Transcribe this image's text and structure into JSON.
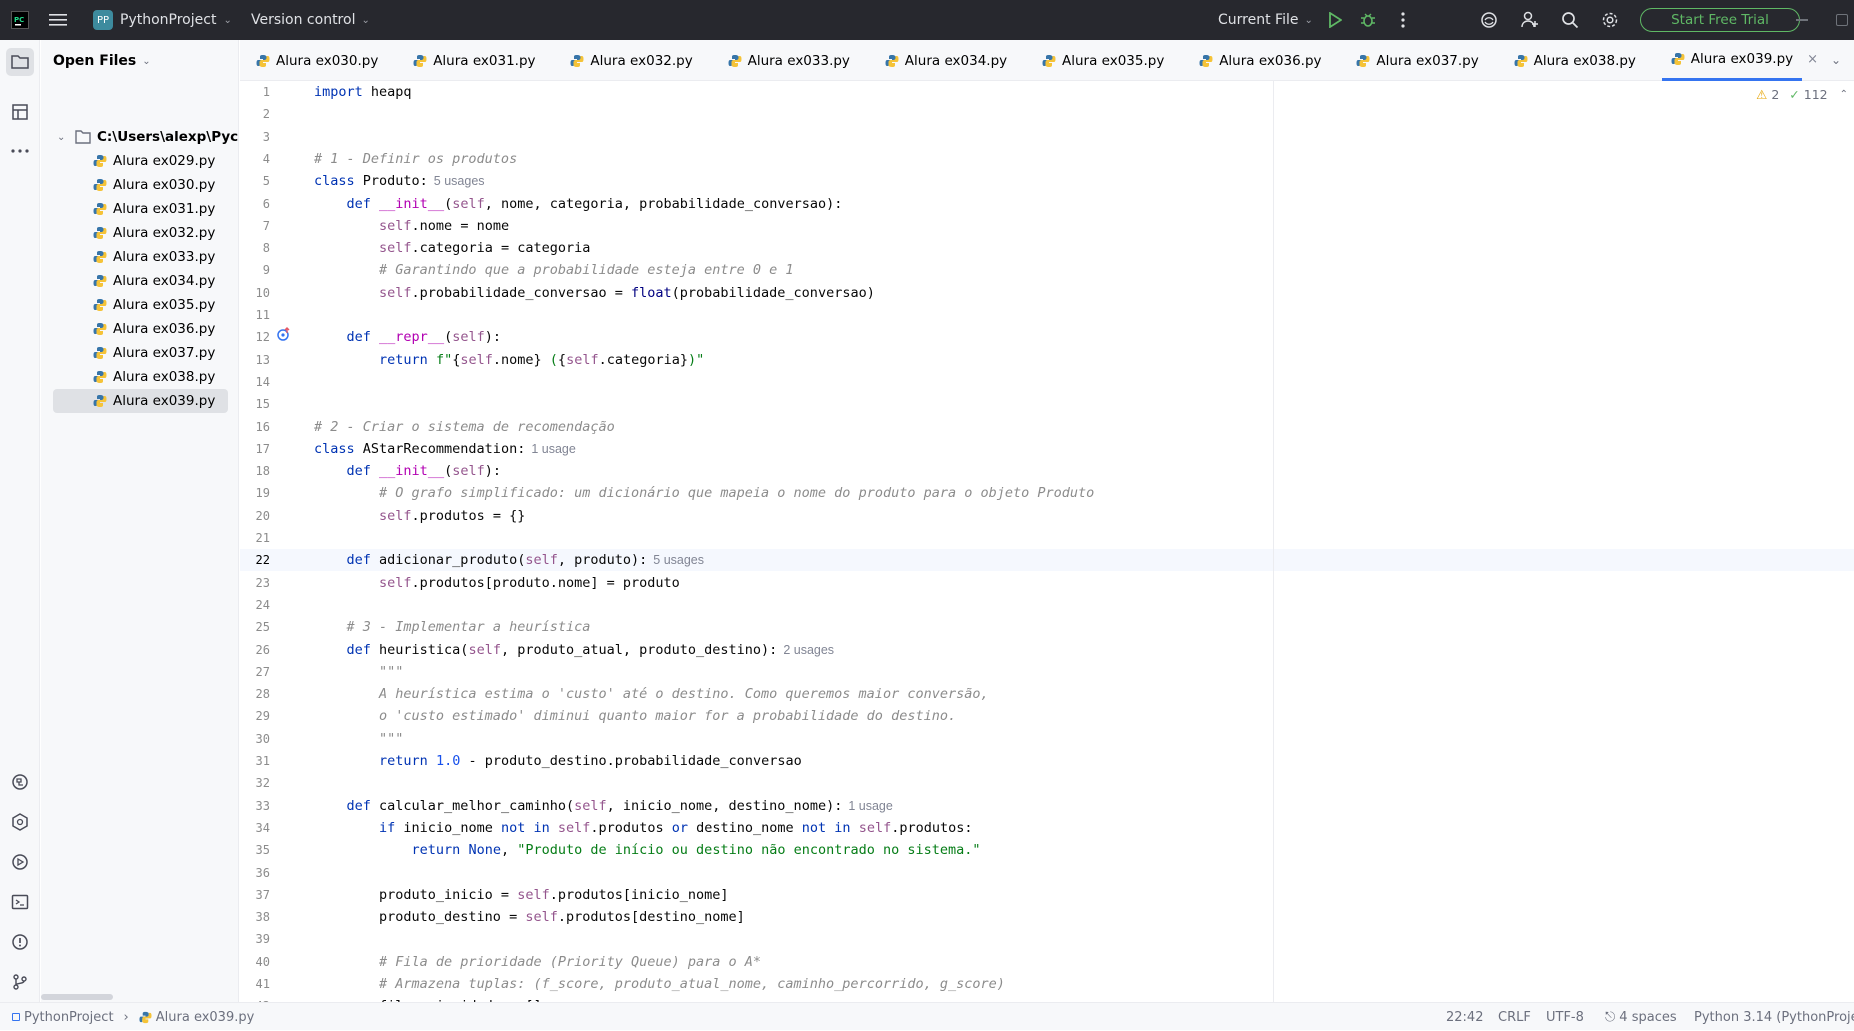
{
  "titlebar": {
    "project_badge": "PP",
    "project_name": "PythonProject",
    "vcs": "Version control",
    "run_config": "Current File",
    "trial_button": "Start Free Trial"
  },
  "project_panel": {
    "header": "Open Files",
    "root": "C:\\Users\\alexp\\Pycharm",
    "files": [
      "Alura ex029.py",
      "Alura ex030.py",
      "Alura ex031.py",
      "Alura ex032.py",
      "Alura ex033.py",
      "Alura ex034.py",
      "Alura ex035.py",
      "Alura ex036.py",
      "Alura ex037.py",
      "Alura ex038.py",
      "Alura ex039.py"
    ],
    "selected": "Alura ex039.py"
  },
  "tabs": [
    "Alura ex030.py",
    "Alura ex031.py",
    "Alura ex032.py",
    "Alura ex033.py",
    "Alura ex034.py",
    "Alura ex035.py",
    "Alura ex036.py",
    "Alura ex037.py",
    "Alura ex038.py",
    "Alura ex039.py"
  ],
  "active_tab": "Alura ex039.py",
  "inspections": {
    "warnings": "2",
    "ok": "112"
  },
  "current_line": 22,
  "code_lines": [
    "import heapq",
    "",
    "",
    "# 1 - Definir os produtos",
    "class Produto:",
    "    def __init__(self, nome, categoria, probabilidade_conversao):",
    "        self.nome = nome",
    "        self.categoria = categoria",
    "        # Garantindo que a probabilidade esteja entre 0 e 1",
    "        self.probabilidade_conversao = float(probabilidade_conversao)",
    "",
    "    def __repr__(self):",
    "        return f\"{self.nome} ({self.categoria})\"",
    "",
    "",
    "# 2 - Criar o sistema de recomendação",
    "class AStarRecommendation:",
    "    def __init__(self):",
    "        # O grafo simplificado: um dicionário que mapeia o nome do produto para o objeto Produto",
    "        self.produtos = {}",
    "",
    "    def adicionar_produto(self, produto):",
    "        self.produtos[produto.nome] = produto",
    "",
    "    # 3 - Implementar a heurística",
    "    def heuristica(self, produto_atual, produto_destino):",
    "        \"\"\"",
    "        A heurística estima o 'custo' até o destino. Como queremos maior conversão,",
    "        o 'custo estimado' diminui quanto maior for a probabilidade do destino.",
    "        \"\"\"",
    "        return 1.0 - produto_destino.probabilidade_conversao",
    "",
    "    def calcular_melhor_caminho(self, inicio_nome, destino_nome):",
    "        if inicio_nome not in self.produtos or destino_nome not in self.produtos:",
    "            return None, \"Produto de início ou destino não encontrado no sistema.\"",
    "",
    "        produto_inicio = self.produtos[inicio_nome]",
    "        produto_destino = self.produtos[destino_nome]",
    "",
    "        # Fila de prioridade (Priority Queue) para o A*",
    "        # Armazena tuplas: (f_score, produto_atual_nome, caminho_percorrido, g_score)",
    "        fila_prioridade = []"
  ],
  "usage_hints": [
    {
      "line": 5,
      "text": "5 usages"
    },
    {
      "line": 17,
      "text": "1 usage"
    },
    {
      "line": 22,
      "text": "5 usages"
    },
    {
      "line": 26,
      "text": "2 usages"
    },
    {
      "line": 33,
      "text": "1 usage"
    }
  ],
  "statusbar": {
    "breadcrumb_project": "PythonProject",
    "breadcrumb_file": "Alura ex039.py",
    "position": "22:42",
    "line_sep": "CRLF",
    "encoding": "UTF-8",
    "indent": "4 spaces",
    "interpreter": "Python 3.14 (PythonProje"
  }
}
